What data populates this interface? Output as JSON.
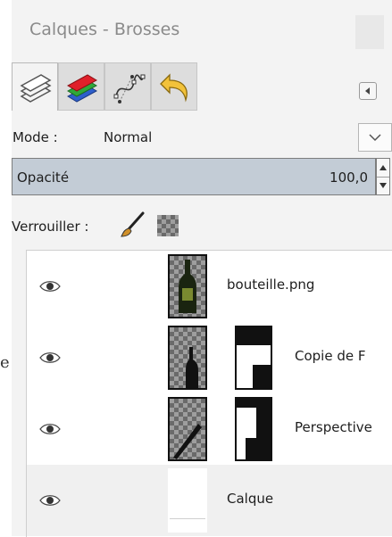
{
  "stray_char": "e",
  "panel": {
    "title": "Calques - Brosses"
  },
  "tabs": [
    {
      "name": "layers-tab",
      "icon": "layers-icon",
      "active": true
    },
    {
      "name": "channels-tab",
      "icon": "channels-icon",
      "active": false
    },
    {
      "name": "paths-tab",
      "icon": "paths-icon",
      "active": false
    },
    {
      "name": "undo-history-tab",
      "icon": "undo-icon",
      "active": false
    }
  ],
  "mode": {
    "label": "Mode :",
    "value": "Normal"
  },
  "opacity": {
    "label": "Opacité",
    "value": "100,0"
  },
  "lock": {
    "label": "Verrouiller :"
  },
  "layers": [
    {
      "name": "bouteille.png",
      "visible": true,
      "has_mask": false,
      "selected": false
    },
    {
      "name": "Copie de F",
      "visible": true,
      "has_mask": true,
      "selected": false
    },
    {
      "name": "Perspective",
      "visible": true,
      "has_mask": true,
      "selected": false
    },
    {
      "name": "Calque",
      "visible": true,
      "has_mask": false,
      "selected": true
    }
  ]
}
